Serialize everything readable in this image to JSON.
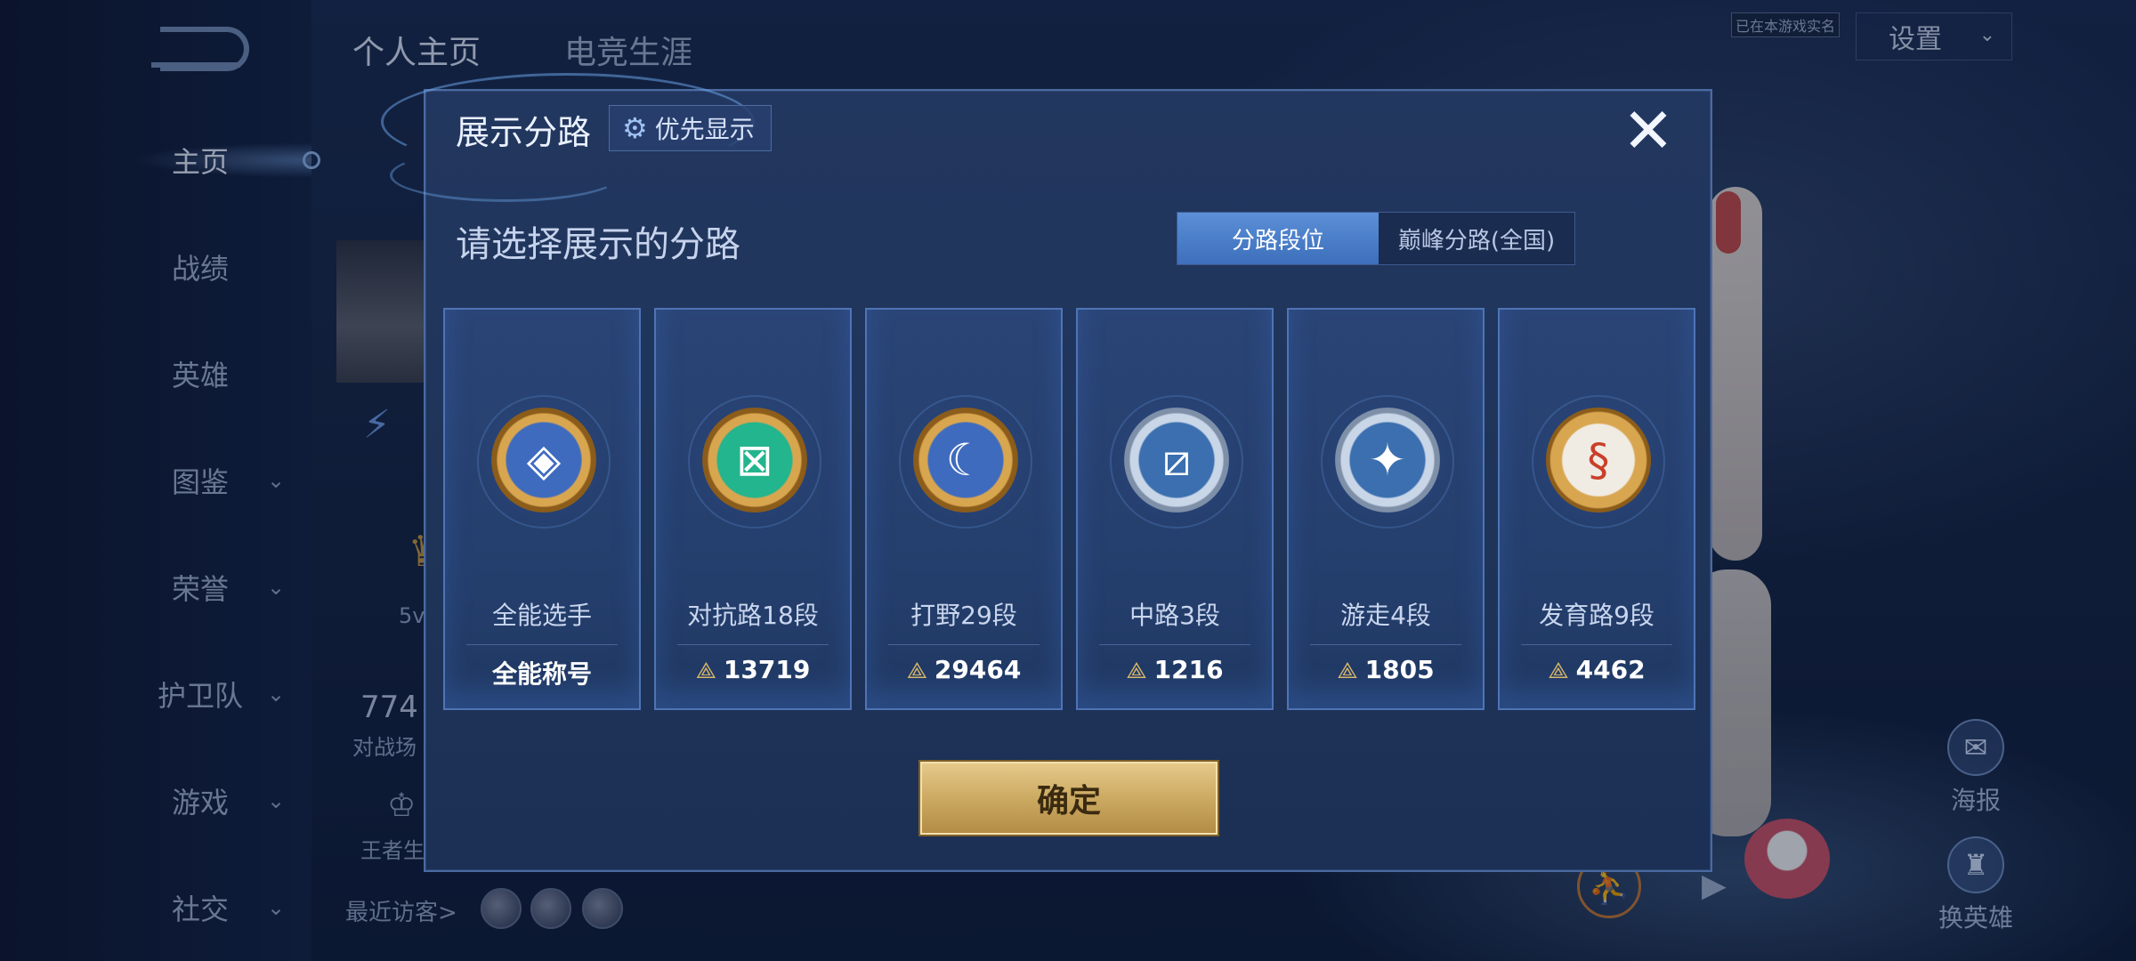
{
  "top_tabs": [
    {
      "label": "个人主页",
      "active": true
    },
    {
      "label": "电竞生涯",
      "active": false
    }
  ],
  "nav": [
    {
      "label": "主页",
      "active": true,
      "has_chevron": false
    },
    {
      "label": "战绩",
      "active": false,
      "has_chevron": false
    },
    {
      "label": "英雄",
      "active": false,
      "has_chevron": false
    },
    {
      "label": "图鉴",
      "active": false,
      "has_chevron": true
    },
    {
      "label": "荣誉",
      "active": false,
      "has_chevron": true
    },
    {
      "label": "护卫队",
      "active": false,
      "has_chevron": true
    },
    {
      "label": "游戏",
      "active": false,
      "has_chevron": true
    },
    {
      "label": "社交",
      "active": false,
      "has_chevron": true
    }
  ],
  "chevron": "⌄",
  "side": {
    "stat_5v": "5v",
    "big_number": "774",
    "battle_label": "对战场",
    "king_label": "王者生",
    "recent_visitors": "最近访客>"
  },
  "header_right": {
    "realname_tag": "已在本游戏实名",
    "settings_label": "设置",
    "poster_label": "海报",
    "swap_hero_label": "换英雄"
  },
  "modal": {
    "title": "展示分路",
    "priority_label": "优先显示",
    "subtitle": "请选择展示的分路",
    "segments": [
      {
        "label": "分路段位",
        "selected": true
      },
      {
        "label": "巅峰分路(全国)",
        "selected": false
      }
    ],
    "cards": [
      {
        "name": "全能选手",
        "score": "全能称号",
        "has_points": false,
        "badge_style": "gold",
        "badge_glyph": "◈"
      },
      {
        "name": "对抗路18段",
        "score": "13719",
        "has_points": true,
        "badge_style": "green",
        "badge_glyph": "⊠"
      },
      {
        "name": "打野29段",
        "score": "29464",
        "has_points": true,
        "badge_style": "gold",
        "badge_glyph": "☾"
      },
      {
        "name": "中路3段",
        "score": "1216",
        "has_points": true,
        "badge_style": "silver",
        "badge_glyph": "⧄"
      },
      {
        "name": "游走4段",
        "score": "1805",
        "has_points": true,
        "badge_style": "silver",
        "badge_glyph": "✦"
      },
      {
        "name": "发育路9段",
        "score": "4462",
        "has_points": true,
        "badge_style": "bronze",
        "badge_glyph": "§"
      }
    ],
    "confirm_label": "确定"
  },
  "icons": {
    "close": "✕",
    "gear": "⚙",
    "points": "⟁",
    "poster": "✉",
    "swap": "♜",
    "walk": "⛹",
    "play": "▶",
    "badge": "⚡",
    "wings": "♛",
    "king": "♔"
  },
  "colors": {
    "modal_bg": "#22375f",
    "accent_blue": "#4f74b6",
    "confirm_gold": "#c9a75f",
    "points_gold": "#d8b66a"
  }
}
